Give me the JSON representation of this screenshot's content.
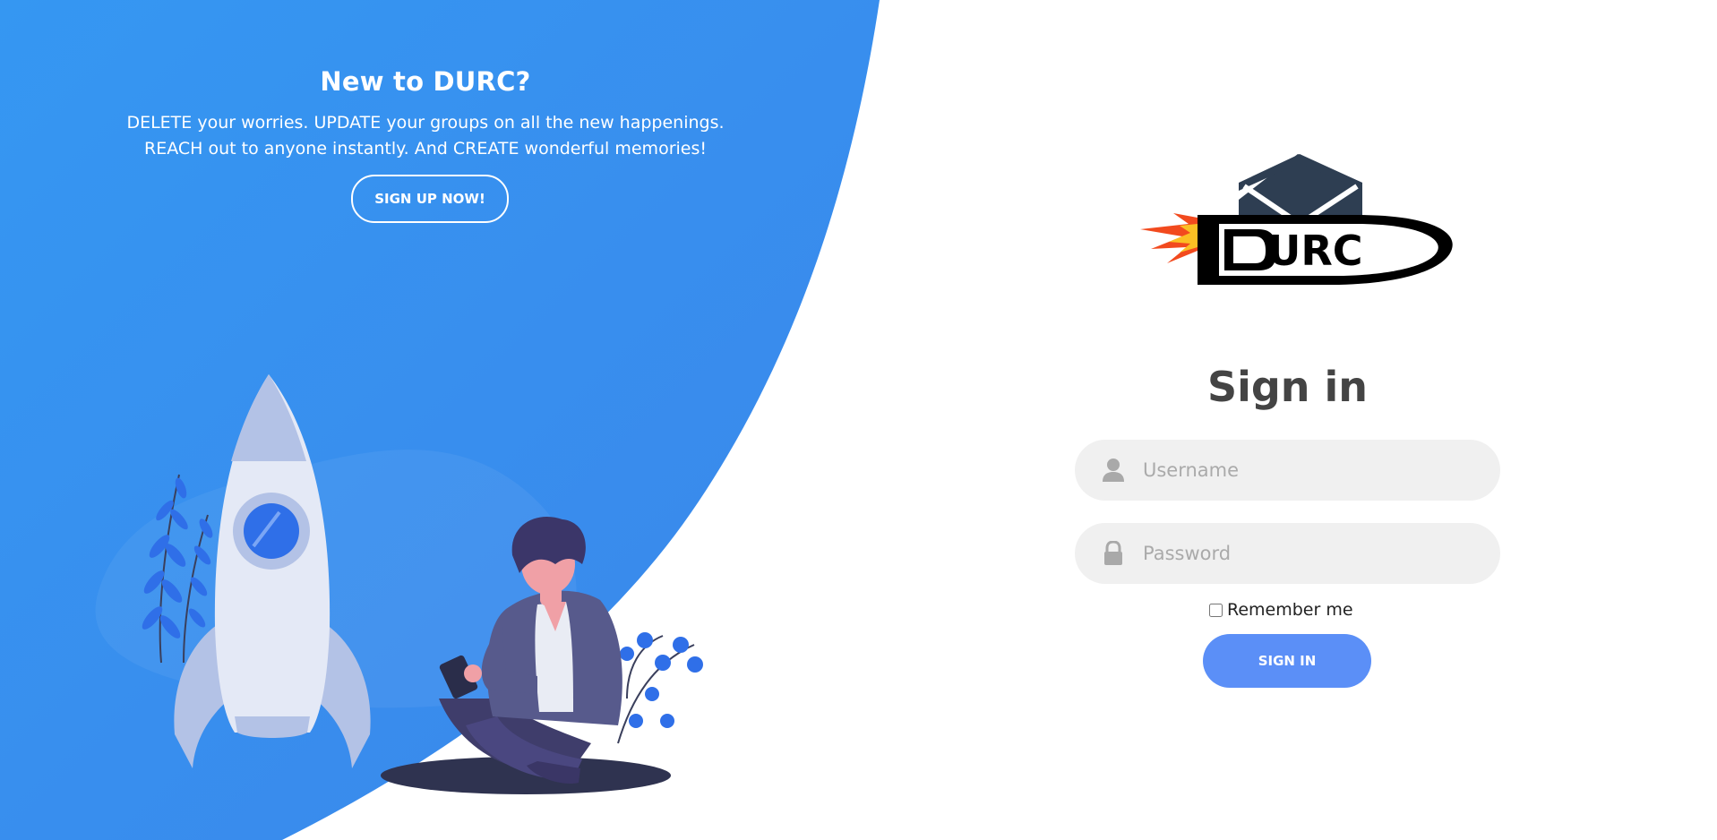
{
  "promo": {
    "title": "New to DURC?",
    "line1": "DELETE your worries. UPDATE your groups on all the new happenings.",
    "line2": "REACH out to anyone instantly. And CREATE wonderful memories!",
    "signup_label": "SIGN UP NOW!"
  },
  "logo": {
    "text": "URC",
    "icon": "envelope-rocket-logo"
  },
  "signin": {
    "title": "Sign in",
    "username_placeholder": "Username",
    "username_value": "",
    "password_placeholder": "Password",
    "password_value": "",
    "remember_label": "Remember me",
    "remember_checked": false,
    "submit_label": "SIGN IN",
    "user_icon": "user-icon",
    "lock_icon": "lock-icon"
  },
  "colors": {
    "blue_panel": "#3a8def",
    "button_blue": "#5b8ff7",
    "title_gray": "#444444",
    "field_bg": "#f0f0f0"
  }
}
